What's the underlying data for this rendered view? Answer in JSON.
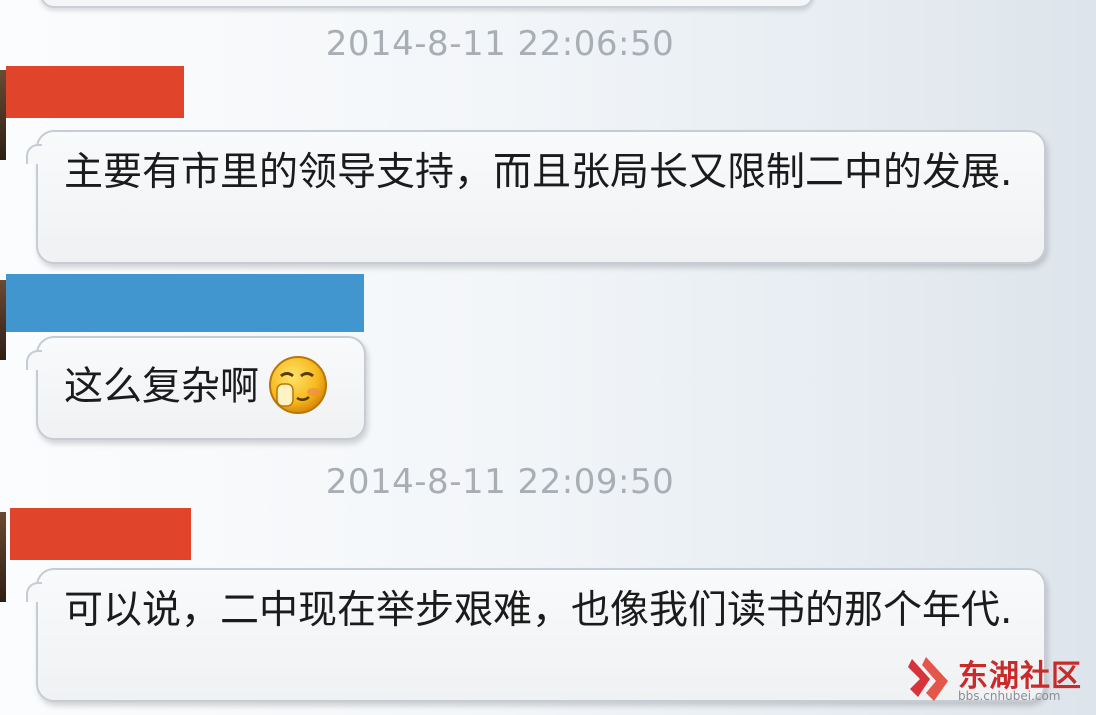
{
  "colors": {
    "name_bar_red": "#e0452c",
    "name_bar_blue": "#4196d0",
    "timestamp": "#a9aeb4",
    "watermark": "#c92a2a"
  },
  "chat": {
    "timestamps": [
      "2014-8-11 22:06:50",
      "2014-8-11 22:09:50"
    ],
    "messages": [
      {
        "sender_bar_color": "red",
        "text": "主要有市里的领导支持，而且张局长又限制二中的发展."
      },
      {
        "sender_bar_color": "blue",
        "text": "这么复杂啊",
        "emoji": "shy-smile-emoji-icon"
      },
      {
        "sender_bar_color": "red",
        "text": "可以说，二中现在举步艰难，也像我们读书的那个年代."
      }
    ]
  },
  "watermark": {
    "logo_text": "东湖社区",
    "url": "bbs.cnhubei.com",
    "icon": "donghu-logo-icon"
  }
}
